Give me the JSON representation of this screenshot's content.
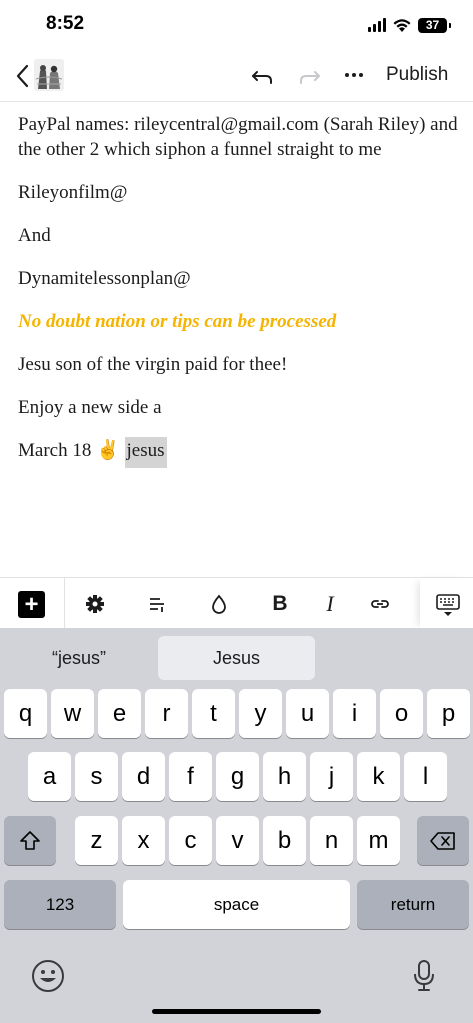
{
  "status_bar": {
    "time": "8:52",
    "battery": "37"
  },
  "toolbar": {
    "back_icon": "chevron-left-icon",
    "undo_icon": "undo-icon",
    "redo_icon": "redo-icon",
    "more_icon": "more-horizontal-icon",
    "publish_label": "Publish"
  },
  "editor": {
    "paragraphs": [
      "PayPal names: rileycentral@gmail.com (Sarah Riley) and the other 2 which siphon a funnel straight to me",
      "Rileyonfilm@",
      "And",
      "Dynamitelessonplan@",
      "No doubt nation or tips can be processed",
      "Jesu son of the virgin paid for thee!",
      "Enjoy a new side a"
    ],
    "last_line_prefix": "March 18 ✌️ ",
    "last_line_selected": "jesus",
    "highlight_color": "#f4b400"
  },
  "format_toolbar": {
    "add_label": "+",
    "bold_label": "B",
    "italic_label": "I",
    "icons": [
      "plus-icon",
      "gear-icon",
      "align-icon",
      "drop-icon",
      "bold-icon",
      "italic-icon",
      "link-icon",
      "keyboard-hide-icon"
    ]
  },
  "keyboard": {
    "suggestions": [
      "“jesus”",
      "Jesus",
      ""
    ],
    "row1": [
      "q",
      "w",
      "e",
      "r",
      "t",
      "y",
      "u",
      "i",
      "o",
      "p"
    ],
    "row2": [
      "a",
      "s",
      "d",
      "f",
      "g",
      "h",
      "j",
      "k",
      "l"
    ],
    "row3": [
      "z",
      "x",
      "c",
      "v",
      "b",
      "n",
      "m"
    ],
    "numbers_label": "123",
    "space_label": "space",
    "return_label": "return"
  }
}
